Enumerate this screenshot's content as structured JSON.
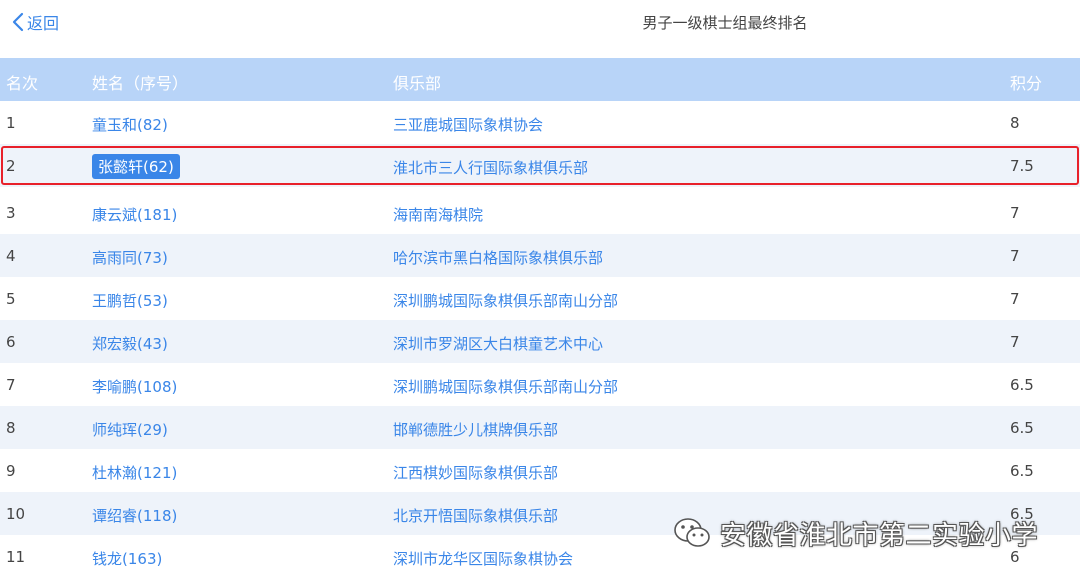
{
  "header": {
    "back_label": "返回",
    "title": "男子一级棋士组最终排名"
  },
  "table": {
    "columns": {
      "rank": "名次",
      "name": "姓名（序号）",
      "club": "俱乐部",
      "score": "积分"
    },
    "rows": [
      {
        "rank": "1",
        "name": "童玉和(82)",
        "club": "三亚鹿城国际象棋协会",
        "score": "8"
      },
      {
        "rank": "2",
        "name": "张懿轩(62)",
        "club": "淮北市三人行国际象棋俱乐部",
        "score": "7.5"
      },
      {
        "rank": "3",
        "name": "康云斌(181)",
        "club": "海南南海棋院",
        "score": "7"
      },
      {
        "rank": "4",
        "name": "高雨同(73)",
        "club": "哈尔滨市黑白格国际象棋俱乐部",
        "score": "7"
      },
      {
        "rank": "5",
        "name": "王鹏哲(53)",
        "club": "深圳鹏城国际象棋俱乐部南山分部",
        "score": "7"
      },
      {
        "rank": "6",
        "name": "郑宏毅(43)",
        "club": "深圳市罗湖区大白棋童艺术中心",
        "score": "7"
      },
      {
        "rank": "7",
        "name": "李喻鹏(108)",
        "club": "深圳鹏城国际象棋俱乐部南山分部",
        "score": "6.5"
      },
      {
        "rank": "8",
        "name": "师纯珲(29)",
        "club": "邯郸德胜少儿棋牌俱乐部",
        "score": "6.5"
      },
      {
        "rank": "9",
        "name": "杜林瀚(121)",
        "club": "江西棋妙国际象棋俱乐部",
        "score": "6.5"
      },
      {
        "rank": "10",
        "name": "谭绍睿(118)",
        "club": "北京开悟国际象棋俱乐部",
        "score": "6.5"
      },
      {
        "rank": "11",
        "name": "钱龙(163)",
        "club": "深圳市龙华区国际象棋协会",
        "score": "6"
      }
    ]
  },
  "highlight": {
    "row_rank": "2",
    "frame_color": "#e8202a"
  },
  "watermark": {
    "text": "安徽省淮北市第二实验小学",
    "icon": "wechat-icon"
  },
  "colors": {
    "accent": "#3a86e8",
    "header_bg": "#b8d4f8",
    "stripe": "#eef3fa"
  }
}
